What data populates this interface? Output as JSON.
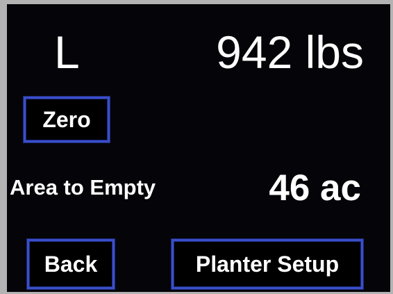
{
  "display": {
    "scale_side": "L",
    "weight_readout": "942 lbs",
    "area_label": "Area to Empty",
    "area_value": "46 ac"
  },
  "buttons": {
    "zero_label": "Zero",
    "back_label": "Back",
    "planter_setup_label": "Planter Setup"
  },
  "colors": {
    "screen_background": "#050509",
    "button_border": "#3a4fc9",
    "text": "#ffffff"
  }
}
